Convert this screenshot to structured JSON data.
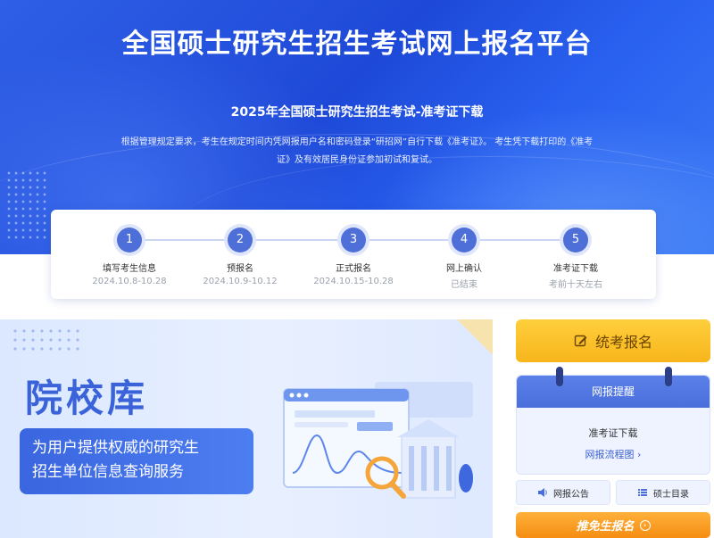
{
  "site": {
    "title": "全国硕士研究生招生考试网上报名平台"
  },
  "notice": {
    "title": "2025年全国硕士研究生招生考试-准考证下载",
    "line1": "根据管理规定要求，考生在规定时间内凭网报用户名和密码登录“研招网”自行下载《准考证》。 考生凭下载打印的《准考",
    "line2": "证》及有效居民身份证参加初试和复试。"
  },
  "steps": [
    {
      "number": "1",
      "name": "填写考生信息",
      "date": "2024.10.8-10.28"
    },
    {
      "number": "2",
      "name": "预报名",
      "date": "2024.10.9-10.12"
    },
    {
      "number": "3",
      "name": "正式报名",
      "date": "2024.10.15-10.28"
    },
    {
      "number": "4",
      "name": "网上确认",
      "date": "已结束"
    },
    {
      "number": "5",
      "name": "准考证下载",
      "date": "考前十天左右"
    }
  ],
  "banner": {
    "title": "院校库",
    "desc_line1": "为用户提供权威的研究生",
    "desc_line2": "招生单位信息查询服务"
  },
  "sidebar": {
    "exam_button": "统考报名",
    "remind_title": "网报提醒",
    "remind_item": "准考证下载",
    "remind_link": "网报流程图 ›",
    "announce": "网报公告",
    "catalog": "硕士目录",
    "exempt": "推免生报名"
  },
  "colors": {
    "primary": "#1e49d8",
    "accent": "#f7b51b",
    "orange": "#f58d12"
  },
  "icons": [
    "edit-icon",
    "speaker-icon",
    "list-icon",
    "arrow-circle-icon",
    "magnifier-icon"
  ]
}
